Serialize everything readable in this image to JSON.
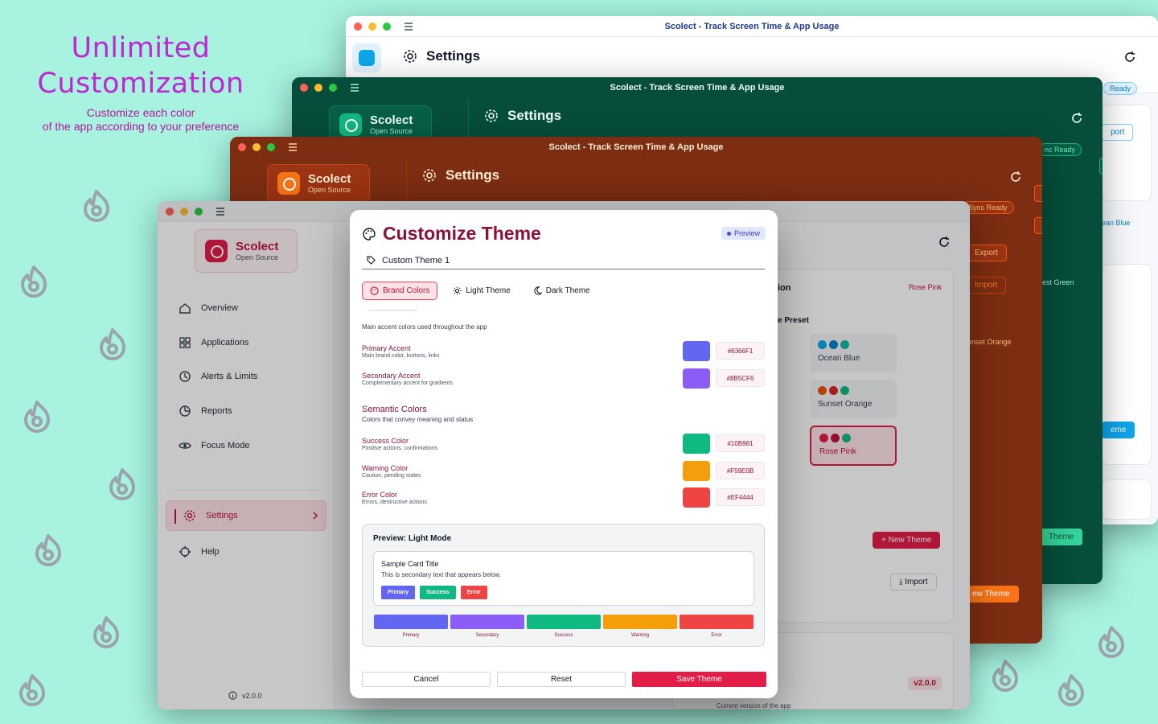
{
  "promo": {
    "title": "Unlimited Customization",
    "sub1": "Customize each color",
    "sub2": "of the app according to your preference"
  },
  "window": {
    "title": "Scolect - Track Screen Time & App Usage"
  },
  "header": {
    "title": "Settings"
  },
  "brand": {
    "name": "Scolect",
    "tagline": "Open Source"
  },
  "back_windows": {
    "chips": {
      "sync": "Sync Ready",
      "sync_short": "Ready",
      "sync_cut": "nc Ready"
    },
    "buttons": {
      "export": "Export",
      "import": "Import",
      "export_cut": "xport",
      "import_cut": "nport",
      "port": "port",
      "theme_cut": "eme",
      "new_theme_cut": "ew Theme",
      "theme_label": "Theme"
    },
    "presets_text": {
      "ocean": "ean Blue",
      "forest": "rest Green",
      "sunset": "unset Orange"
    }
  },
  "sidebar": {
    "items": [
      {
        "label": "Overview",
        "icon": "home-icon"
      },
      {
        "label": "Applications",
        "icon": "grid-icon"
      },
      {
        "label": "Alerts & Limits",
        "icon": "clock-alert-icon"
      },
      {
        "label": "Reports",
        "icon": "report-icon"
      },
      {
        "label": "Focus Mode",
        "icon": "eye-icon"
      },
      {
        "label": "Settings",
        "icon": "gear-icon"
      },
      {
        "label": "Help",
        "icon": "help-icon"
      }
    ],
    "version": "v2.0.0"
  },
  "main_bg": {
    "section_title_cut": "ion",
    "preset_heading_cut": "e Preset",
    "current_preset": "Rose Pink",
    "presets": [
      {
        "name": "Ocean Blue",
        "colors": [
          "#0ea5e9",
          "#0284c7",
          "#14b8a6"
        ]
      },
      {
        "name": "Sunset Orange",
        "colors": [
          "#ea580c",
          "#dc2626",
          "#10b981"
        ]
      },
      {
        "name": "Rose Pink",
        "colors": [
          "#e11d48",
          "#be123c",
          "#10b981"
        ]
      }
    ],
    "new_theme": "New Theme",
    "import": "Import",
    "version_badge": "v2.0.0",
    "version_desc": "Current version of the app"
  },
  "modal": {
    "title": "Customize Theme",
    "badge": "Preview",
    "name_value": "Custom Theme 1",
    "tabs": [
      {
        "label": "Brand Colors",
        "active": true
      },
      {
        "label": "Light Theme",
        "active": false
      },
      {
        "label": "Dark Theme",
        "active": false
      }
    ],
    "brand_desc": "Main accent colors used throughout the app",
    "brand_colors": [
      {
        "label": "Primary Accent",
        "sub": "Main brand color, buttons, links",
        "hex": "#6366F1"
      },
      {
        "label": "Secondary Accent",
        "sub": "Complementary accent for gradients",
        "hex": "#8B5CF6"
      }
    ],
    "semantic_title": "Semantic Colors",
    "semantic_desc": "Colors that convey meaning and status",
    "semantic_colors": [
      {
        "label": "Success Color",
        "sub": "Positive actions, confirmations",
        "hex": "#10B981"
      },
      {
        "label": "Warning Color",
        "sub": "Caution, pending states",
        "hex": "#F59E0B"
      },
      {
        "label": "Error Color",
        "sub": "Errors, destructive actions",
        "hex": "#EF4444"
      }
    ],
    "preview": {
      "title": "Preview: Light Mode",
      "card_title": "Sample Card Title",
      "card_sub": "This is secondary text that appears below.",
      "buttons": [
        "Primary",
        "Success",
        "Error"
      ],
      "strip": [
        {
          "label": "Primary",
          "color": "#6366F1"
        },
        {
          "label": "Secondary",
          "color": "#8B5CF6"
        },
        {
          "label": "Success",
          "color": "#10B981"
        },
        {
          "label": "Warning",
          "color": "#F59E0B"
        },
        {
          "label": "Error",
          "color": "#EF4444"
        }
      ]
    },
    "footer": {
      "cancel": "Cancel",
      "reset": "Reset",
      "save": "Save Theme"
    }
  }
}
